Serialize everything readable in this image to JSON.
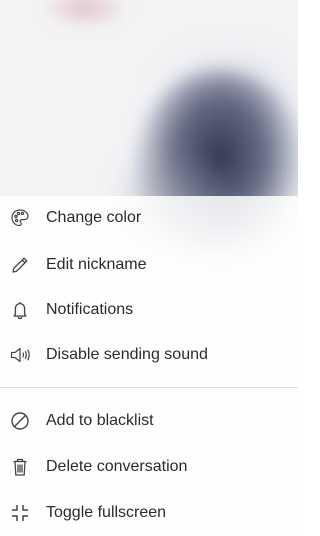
{
  "menu": {
    "items": [
      {
        "label": "Change color",
        "icon": "palette-icon"
      },
      {
        "label": "Edit nickname",
        "icon": "pencil-icon"
      },
      {
        "label": "Notifications",
        "icon": "bell-icon"
      },
      {
        "label": "Disable sending sound",
        "icon": "speaker-icon"
      },
      {
        "label": "Add to blacklist",
        "icon": "block-icon"
      },
      {
        "label": "Delete conversation",
        "icon": "trash-icon"
      },
      {
        "label": "Toggle fullscreen",
        "icon": "exit-fullscreen-icon"
      }
    ]
  },
  "colors": {
    "text": "#2b2b2b",
    "icon": "#444444",
    "divider": "#d9d9d9"
  }
}
